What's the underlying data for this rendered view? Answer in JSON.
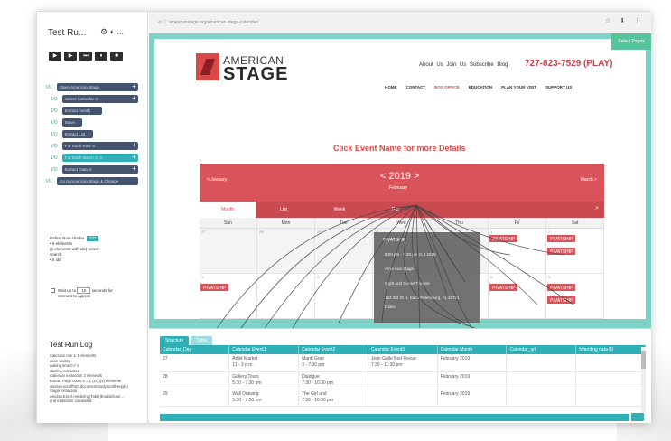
{
  "tool": {
    "title": "Test Ru...",
    "title_icons": "⚙ ◐ ...",
    "run_buttons": [
      "▶",
      "▶",
      "⏭",
      "⏸",
      "■"
    ],
    "steps": [
      {
        "io": "I/O",
        "label": "Open American Stage",
        "plus": "+",
        "teal": false
      },
      {
        "io": "I/O",
        "label": "Select Calendar ⊙",
        "plus": "+",
        "teal": false
      },
      {
        "io": "I/O",
        "label": "Extract month",
        "plus": "",
        "teal": false
      },
      {
        "io": "I/O",
        "label": "Move",
        "plus": "",
        "teal": false
      },
      {
        "io": "I/O",
        "label": "Extract List",
        "plus": "",
        "teal": false
      },
      {
        "io": "I/O",
        "label": "For Each Row ⊙",
        "plus": "+",
        "teal": false
      },
      {
        "io": "I/O",
        "label": "For Each Match ⊙ ⊙",
        "plus": "+",
        "teal": true
      },
      {
        "io": "I/O",
        "label": "Extract Data ⊙",
        "plus": "+",
        "teal": false
      },
      {
        "io": "I/O",
        "label": "Go to American Stage & Change",
        "plus": "",
        "teal": false
      }
    ],
    "mid_line1": "Define Row shader",
    "mid_go": "GO",
    "mid_lines": [
      "• 6 elements",
      "(6 elements with ids)-select",
      "search",
      "• 6 ids"
    ],
    "check_label": "Wait up to",
    "check_value": "10",
    "check_unit": "seconds for",
    "check_line2": "element to appear",
    "log_title": "Test Run Log",
    "log_lines": [
      "Calendar row 1: 9 elements",
      "done waiting",
      "waiting time 0.7 s",
      "starting extraction",
      "Calendar extraction 3 elements",
      "Extract Page count 0 = 1 (2/1)(1) elements",
      "window.scrollTo(0,document.body.scrollHeight)",
      "Stage extraction",
      "window.Excel.rendering(Table)Enable/Use...",
      "end extraction calculated"
    ]
  },
  "browser": {
    "address": "⊙  ⓘ  americanstage.org/american-stage-calendar/",
    "icons": "☆ ⬇ ⋮"
  },
  "site": {
    "logo_line1": "AMERICAN",
    "logo_line2": "STAGE",
    "top_links": "About Us  Join Us  Subscribe  Blog",
    "phone": "727-823-7529 (PLAY)",
    "nav": [
      "HOME",
      "CONTACT",
      "BOX OFFICE",
      "EDUCATION",
      "PLAN YOUR VISIT",
      "SUPPORT US"
    ],
    "nav_active_index": 2,
    "corner_button": "Select Pages",
    "click_title": "Click Event Name for more Details"
  },
  "calendar": {
    "prev": "< January",
    "next": "March >",
    "year": "< 2019 >",
    "month": "February",
    "tabs": [
      "Month",
      "List",
      "Week",
      "Day"
    ],
    "active_tab": 0,
    "search_icon": "⌕",
    "days": [
      "Sun",
      "Mon",
      "Tue",
      "Wed",
      "Thu",
      "Fri",
      "Sat"
    ],
    "cells": [
      "27",
      "28",
      "29",
      "30",
      "31",
      "1",
      "2",
      "3",
      "4",
      "5",
      "6",
      "7",
      "8",
      "9"
    ],
    "events": [
      {
        "label": "PIVATSHIP",
        "row": 0,
        "col": 5
      },
      {
        "label": "PIVATSHIP",
        "row": 0,
        "col": 6
      },
      {
        "label": "PIVATSHIP",
        "row": 0,
        "col": 6,
        "second": true
      },
      {
        "label": "PIVATSHIP",
        "row": 1,
        "col": 0
      },
      {
        "label": "PIVATSHIP",
        "row": 1,
        "col": 5
      },
      {
        "label": "PIVATSHIP",
        "row": 1,
        "col": 6
      },
      {
        "label": "PIVATSHIP",
        "row": 1,
        "col": 6,
        "second": true
      }
    ],
    "popup": {
      "title": "PIVATSHIP",
      "lines": [
        "8:00 pm - 9:30 pm   ⊙ 3 2019",
        "American Stage",
        "Sight and Sense Theatre",
        "163 3rd St N, Saint Petersburg, FL 33701",
        "Dates"
      ]
    }
  },
  "panel": {
    "tabs": [
      "Structure",
      "Table"
    ],
    "columns": [
      "Calendar_Day",
      "Calendar Event1",
      "Calendar Event2",
      "Calendar Event3",
      "Calendar Month",
      "Calendar_url",
      "Inheriting data ID"
    ],
    "rows": [
      [
        "27",
        "Artist Market\n11 - 3 p.m.",
        "Mardi Gras\n3 - 7:30 pm",
        "Jean Galle Bed Revue\n7:30 - 11:30 pm",
        "February 2019",
        "",
        ""
      ],
      [
        "28",
        "Gallery Tours\n5:30 - 7:30 pm",
        "Dialogue\n7:30 - 10:30 pm",
        "",
        "February 2019",
        "",
        ""
      ],
      [
        "29",
        "Wall Drawing\n5:30 - 7:30 pm",
        "The Girl and\n7:30 - 10:30 pm",
        "",
        "February 2019",
        "",
        ""
      ]
    ]
  },
  "colors": {
    "brand_red": "#d9545a",
    "teal": "#2fb0b7",
    "page_bg": "#7dd2c7"
  }
}
